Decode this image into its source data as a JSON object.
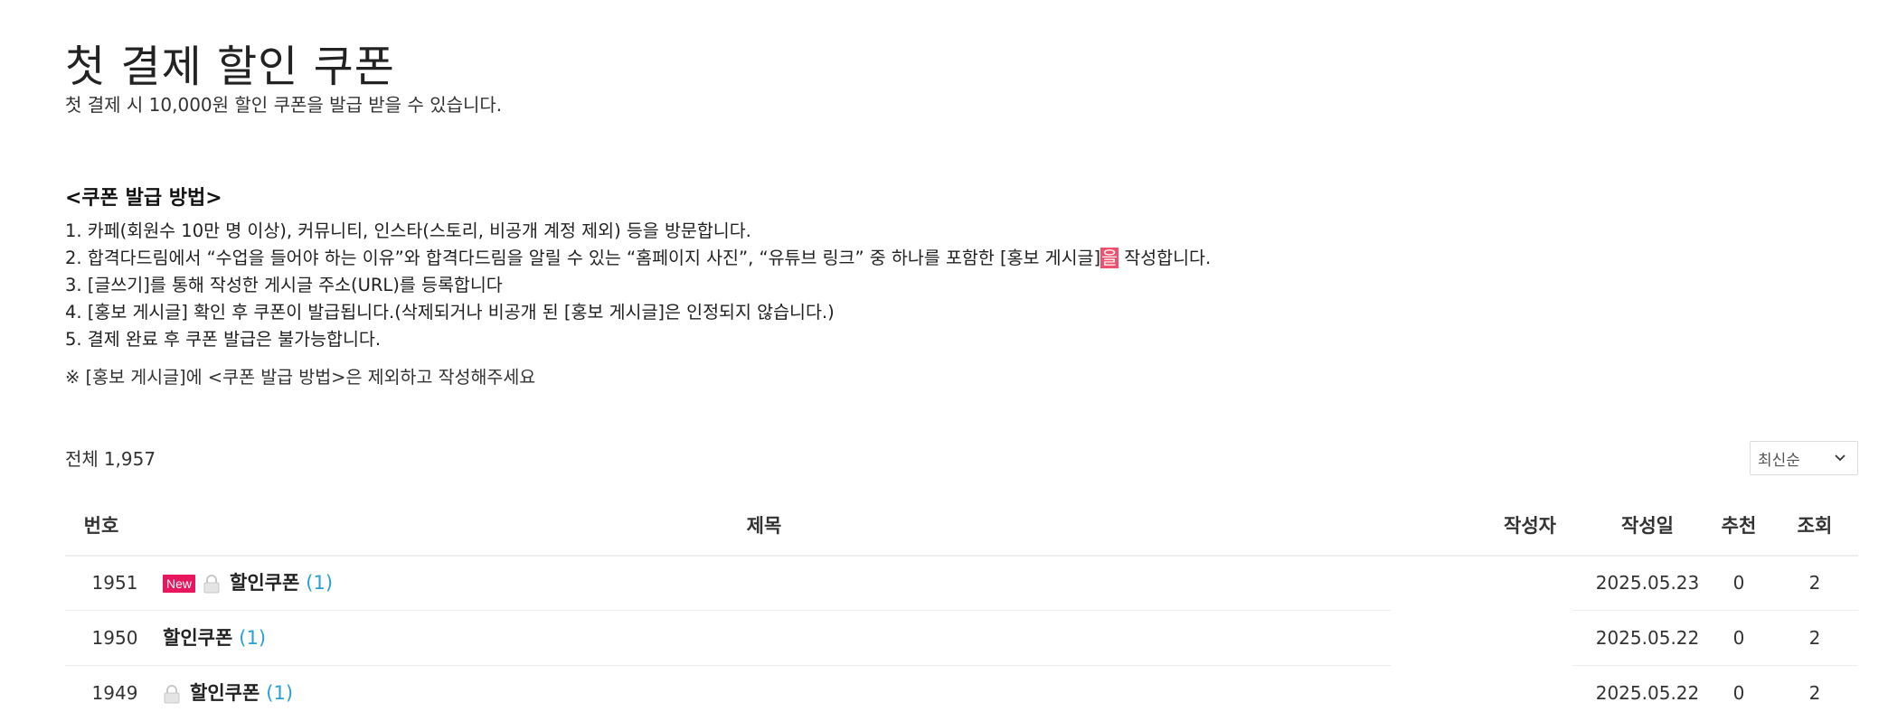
{
  "header": {
    "title": "첫 결제 할인 쿠폰",
    "subtitle": "첫 결제 시 10,000원 할인 쿠폰을 발급 받을 수 있습니다."
  },
  "guide": {
    "heading": "<쿠폰 발급 방법>",
    "step1": "1. 카페(회원수 10만 명 이상), 커뮤니티, 인스타(스토리, 비공개 계정 제외) 등을 방문합니다.",
    "step2_before": "2. 합격다드림에서 “수업을 들어야 하는 이유”와 합격다드림을 알릴 수 있는 “홈페이지 사진”, “유튜브 링크” 중 하나를 포함한 [홍보 게시글]",
    "step2_highlight": "을",
    "step2_after": " 작성합니다.",
    "step3": "3. [글쓰기]를 통해 작성한 게시글 주소(URL)를 등록합니다",
    "step4": "4. [홍보 게시글] 확인 후 쿠폰이 발급됩니다.(삭제되거나 비공개 된 [홍보 게시글]은 인정되지 않습니다.)",
    "step5": "5. 결제 완료 후 쿠폰 발급은 불가능합니다.",
    "note": "※ [홍보 게시글]에 <쿠폰 발급 방법>은 제외하고 작성해주세요",
    "highlight_color": "#f0506e"
  },
  "list": {
    "total_label": "전체",
    "total_count": "1,957",
    "sort_value": "최신순",
    "columns": {
      "number": "번호",
      "title": "제목",
      "author": "작성자",
      "date": "작성일",
      "likes": "추천",
      "views": "조회"
    },
    "rows": [
      {
        "number": "1951",
        "badge": "New",
        "locked": true,
        "title": "할인쿠폰",
        "comments": "(1)",
        "author": "",
        "date": "2025.05.23",
        "likes": "0",
        "views": "2"
      },
      {
        "number": "1950",
        "badge": "",
        "locked": false,
        "title": "할인쿠폰",
        "comments": "(1)",
        "author": "",
        "date": "2025.05.22",
        "likes": "0",
        "views": "2"
      },
      {
        "number": "1949",
        "badge": "",
        "locked": true,
        "title": "할인쿠폰",
        "comments": "(1)",
        "author": "",
        "date": "2025.05.22",
        "likes": "0",
        "views": "2"
      }
    ],
    "new_badge_color": "#e8175d",
    "comment_color": "#2a9fd6"
  },
  "icons": {
    "lock": "lock-icon",
    "sort_chevron": "chevron-down-icon"
  }
}
